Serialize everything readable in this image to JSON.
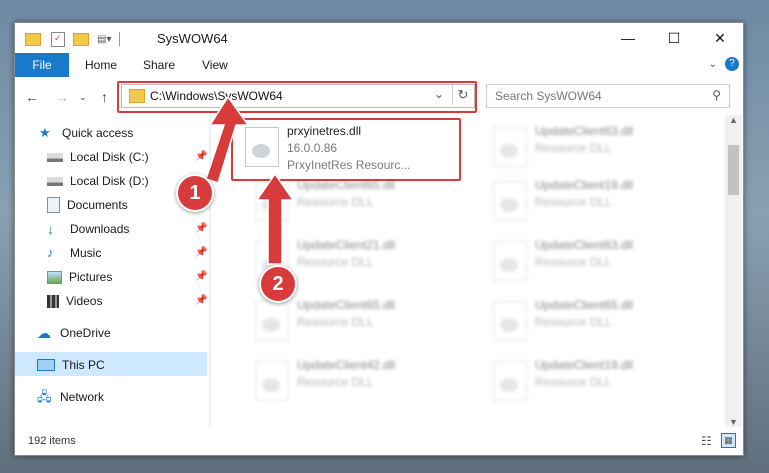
{
  "window": {
    "title": "SysWOW64",
    "controls": {
      "minimize": "—",
      "maximize": "☐",
      "close": "✕"
    }
  },
  "ribbon": {
    "tabs": [
      "File",
      "Home",
      "Share",
      "View"
    ],
    "expand_icon": "chevron-down-icon",
    "help_icon": "help-icon"
  },
  "address_bar": {
    "path": "C:\\Windows\\SysWOW64",
    "search_placeholder": "Search SysWOW64"
  },
  "sidebar": {
    "quick_access": "Quick access",
    "items": [
      {
        "label": "Local Disk (C:)",
        "icon": "drive-icon",
        "pinned": true
      },
      {
        "label": "Local Disk (D:)",
        "icon": "drive-icon",
        "pinned": false
      },
      {
        "label": "Documents",
        "icon": "documents-icon",
        "pinned": true
      },
      {
        "label": "Downloads",
        "icon": "downloads-icon",
        "pinned": true
      },
      {
        "label": "Music",
        "icon": "music-icon",
        "pinned": true
      },
      {
        "label": "Pictures",
        "icon": "pictures-icon",
        "pinned": true
      },
      {
        "label": "Videos",
        "icon": "videos-icon",
        "pinned": true
      }
    ],
    "onedrive": "OneDrive",
    "this_pc": "This PC",
    "network": "Network"
  },
  "files": {
    "highlighted": {
      "name": "prxyinetres.dll",
      "version": "16.0.0.86",
      "description": "PrxyInetRes Resourc..."
    },
    "col1": [
      {
        "name": "UpdateClient65.dll",
        "type": "Resource DLL"
      },
      {
        "name": "UpdateClient21.dll",
        "type": "Resource DLL"
      },
      {
        "name": "UpdateClient65.dll",
        "type": "Resource DLL"
      },
      {
        "name": "UpdateClient42.dll",
        "type": "Resource DLL"
      }
    ],
    "col2": [
      {
        "name": "UpdateClient63.dll",
        "type": "Resource DLL"
      },
      {
        "name": "UpdateClient19.dll",
        "type": "Resource DLL"
      },
      {
        "name": "UpdateClient63.dll",
        "type": "Resource DLL"
      },
      {
        "name": "UpdateClient65.dll",
        "type": "Resource DLL"
      },
      {
        "name": "UpdateClient19.dll",
        "type": "Resource DLL"
      }
    ]
  },
  "status": {
    "item_count": "192 items"
  },
  "callouts": [
    "1",
    "2"
  ],
  "colors": {
    "accent": "#1979ca",
    "callout": "#d83b3b",
    "selected": "#cde8ff"
  }
}
